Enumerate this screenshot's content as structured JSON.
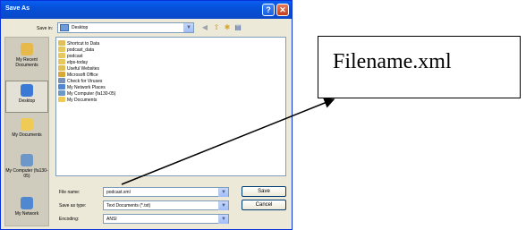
{
  "dialog": {
    "title": "Save As",
    "help_glyph": "?",
    "close_glyph": "✕",
    "save_in_label": "Save in:",
    "save_in_value": "Desktop"
  },
  "places": [
    {
      "label": "My Recent Documents",
      "color": "#e6b94a"
    },
    {
      "label": "Desktop",
      "color": "#3b79d6"
    },
    {
      "label": "My Documents",
      "color": "#efcb56"
    },
    {
      "label": "My Computer (fa130-05)",
      "color": "#6d96c9"
    },
    {
      "label": "My Network",
      "color": "#4f88d0"
    }
  ],
  "files": [
    {
      "name": "Shortcut to Data",
      "color": "#e0bf58"
    },
    {
      "name": "podcast_data",
      "color": "#e8c75f"
    },
    {
      "name": "podcast",
      "color": "#e8c75f"
    },
    {
      "name": "elps-today",
      "color": "#e8c75f"
    },
    {
      "name": "Useful Websites",
      "color": "#e0bf58"
    },
    {
      "name": "Microsoft Office",
      "color": "#d9a937"
    },
    {
      "name": "Check for Viruses",
      "color": "#7a91b6"
    },
    {
      "name": "My Network Places",
      "color": "#4f88d0"
    },
    {
      "name": "My Computer (fa130-05)",
      "color": "#6d96c9"
    },
    {
      "name": "My Documents",
      "color": "#efcb56"
    }
  ],
  "form": {
    "file_name_label": "File name:",
    "file_name_value": "podcast.xml",
    "save_type_label": "Save as type:",
    "save_type_value": "Text Documents (*.txt)",
    "encoding_label": "Encoding:",
    "encoding_value": "ANSI"
  },
  "buttons": {
    "save": "Save",
    "cancel": "Cancel"
  },
  "callout": {
    "text": "Filename.xml"
  }
}
